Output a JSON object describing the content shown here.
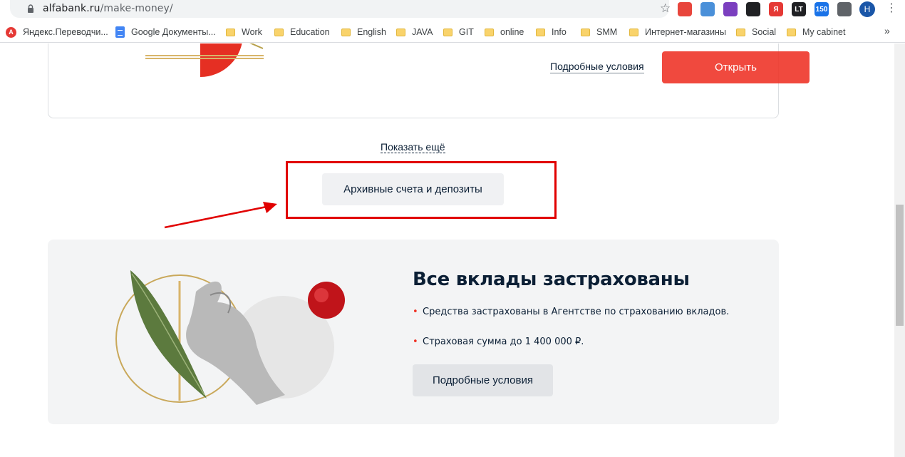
{
  "browser": {
    "url_host": "alfabank.ru",
    "url_path": "/make-money/",
    "profile_initial": "Н",
    "extensions": [
      {
        "name": "extension-1-icon",
        "label": "",
        "color": "#e8453c"
      },
      {
        "name": "cloud-extension-icon",
        "label": "",
        "color": "#4a90d9"
      },
      {
        "name": "feather-extension-icon",
        "label": "",
        "color": "#7b3fbf"
      },
      {
        "name": "extension-4-icon",
        "label": "",
        "color": "#202124"
      },
      {
        "name": "yandex-extension-icon",
        "label": "Я",
        "color": "#e53935"
      },
      {
        "name": "lt-extension-icon",
        "label": "LT",
        "color": "#202124"
      },
      {
        "name": "counter-extension-icon",
        "label": "150",
        "color": "#1a73e8"
      },
      {
        "name": "puzzle-icon",
        "label": "",
        "color": "#5f6368"
      }
    ]
  },
  "bookmarks": [
    {
      "label": "Яндекс.Переводчи...",
      "icon": "yandex-translate-icon"
    },
    {
      "label": "Google Документы...",
      "icon": "google-docs-icon"
    },
    {
      "label": "Work",
      "icon": "folder-icon"
    },
    {
      "label": "Education",
      "icon": "folder-icon"
    },
    {
      "label": "English",
      "icon": "folder-icon"
    },
    {
      "label": "JAVA",
      "icon": "folder-icon"
    },
    {
      "label": "GIT",
      "icon": "folder-icon"
    },
    {
      "label": "online",
      "icon": "folder-icon"
    },
    {
      "label": "Info",
      "icon": "folder-icon"
    },
    {
      "label": "SMM",
      "icon": "folder-icon"
    },
    {
      "label": "Интернет-магазины",
      "icon": "folder-icon"
    },
    {
      "label": "Social",
      "icon": "folder-icon"
    },
    {
      "label": "My cabinet",
      "icon": "folder-icon"
    }
  ],
  "deposit_card": {
    "details_link": "Подробные условия",
    "open_button": "Открыть"
  },
  "show_more": "Показать ещё",
  "archive_button": "Архивные счета и депозиты",
  "insurance": {
    "title": "Все вклады застрахованы",
    "items": [
      "Средства застрахованы в Агентстве по страхованию вкладов.",
      "Страховая сумма до 1 400 000 ₽."
    ],
    "details_button": "Подробные условия"
  },
  "colors": {
    "accent": "#ef3124",
    "annotation": "#e10000",
    "text": "#0b1f35"
  }
}
